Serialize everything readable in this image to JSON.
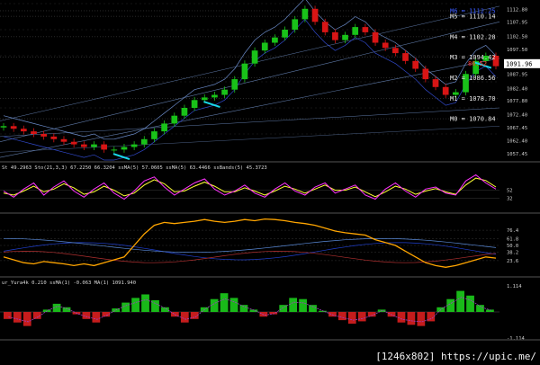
{
  "colors": {
    "background": "#000000",
    "bull": "#19c219",
    "bear": "#d81515",
    "grid": "#2a2a2a",
    "channel": "#5f7aa8",
    "level_text": "#e8e8e8",
    "level_text_blue": "#3a5bff",
    "price_label": "#ff3030",
    "arrow": "#19d8e8",
    "stoch_main": "#ff33ff",
    "stoch_sig": "#ffff33",
    "osc_orange": "#ffa500",
    "hist_pos": "#19b919",
    "hist_neg": "#c51c1c"
  },
  "chart_data": [
    {
      "type": "line",
      "name": "price",
      "x": [
        0,
        10,
        20,
        30,
        40,
        50,
        60,
        70,
        80,
        90,
        100,
        110,
        120,
        130,
        140,
        150,
        160,
        170,
        180,
        190,
        200,
        210,
        220,
        230,
        240,
        250,
        260,
        270,
        280,
        290,
        300,
        310,
        320,
        330,
        340,
        350,
        360,
        370,
        380,
        390,
        400,
        410,
        420,
        430,
        440,
        450,
        460,
        470,
        480,
        490
      ],
      "y": [
        1068,
        1067,
        1066,
        1065,
        1064,
        1063,
        1062,
        1061,
        1060,
        1061,
        1059,
        1059,
        1060,
        1061,
        1063,
        1066,
        1069,
        1072,
        1075,
        1078,
        1079,
        1080,
        1082,
        1086,
        1092,
        1097,
        1100,
        1102,
        1105,
        1109,
        1113,
        1108,
        1104,
        1101,
        1103,
        1106,
        1104,
        1100,
        1098,
        1096,
        1093,
        1090,
        1086,
        1083,
        1080,
        1081,
        1088,
        1093,
        1095,
        1091
      ],
      "ylim": [
        1055,
        1115
      ],
      "y_axis_ticks": [
        "1112.80",
        "1107.95",
        "1102.50",
        "1097.50",
        "1092.75",
        "1087.95",
        "1082.40",
        "1077.80",
        "1072.40",
        "1067.45",
        "1062.40",
        "1057.45"
      ],
      "current_price": "1091.96",
      "levels": [
        {
          "label": "M6 = 1112.25",
          "value": 1112.25,
          "style": "blue"
        },
        {
          "label": "M5 = 1110.14",
          "value": 1110.14,
          "style": "white"
        },
        {
          "label": "M4 = 1102.28",
          "value": 1102.28,
          "style": "white"
        },
        {
          "label": "M3 = 1094.42",
          "value": 1094.42,
          "style": "white"
        },
        {
          "label": "M2 = 1086.56",
          "value": 1086.56,
          "style": "white"
        },
        {
          "label": "M1 = 1078.70",
          "value": 1078.7,
          "style": "white"
        },
        {
          "label": "M0 = 1070.84",
          "value": 1070.84,
          "style": "white"
        }
      ],
      "price_labels": [
        {
          "label": "86.52",
          "value": 1092.0
        }
      ]
    },
    {
      "type": "line",
      "name": "stochastic",
      "header": "St 49.2963  Sto(21,3,3) 67.2250 66.3204  ssMA(5) 57.0605  ssMA(5) 63.4466  ssBands(5) 45.3723",
      "y_axis_ticks": [
        "52",
        "32"
      ],
      "ylim": [
        0,
        100
      ],
      "main": [
        50,
        35,
        55,
        70,
        40,
        60,
        75,
        50,
        35,
        55,
        70,
        45,
        30,
        50,
        75,
        85,
        60,
        40,
        55,
        70,
        80,
        55,
        40,
        50,
        65,
        45,
        35,
        55,
        70,
        50,
        40,
        60,
        70,
        45,
        55,
        65,
        40,
        30,
        55,
        70,
        50,
        35,
        55,
        60,
        45,
        40,
        75,
        90,
        70,
        55
      ],
      "signal": [
        45,
        40,
        50,
        62,
        48,
        55,
        68,
        58,
        42,
        48,
        62,
        52,
        38,
        45,
        65,
        78,
        68,
        48,
        50,
        62,
        72,
        62,
        48,
        48,
        58,
        50,
        40,
        50,
        62,
        55,
        45,
        55,
        65,
        52,
        52,
        60,
        48,
        36,
        48,
        62,
        55,
        42,
        50,
        56,
        48,
        42,
        65,
        82,
        76,
        60
      ]
    },
    {
      "type": "line",
      "name": "oscillator",
      "y_axis_ticks": [
        "76.4",
        "61.8",
        "50.0",
        "38.2",
        "23.6"
      ],
      "ylim": [
        0,
        100
      ],
      "orange": [
        30,
        25,
        20,
        18,
        22,
        20,
        18,
        15,
        18,
        15,
        20,
        25,
        30,
        50,
        70,
        85,
        90,
        88,
        90,
        92,
        95,
        92,
        90,
        92,
        95,
        93,
        96,
        95,
        93,
        90,
        88,
        85,
        80,
        75,
        72,
        70,
        68,
        60,
        55,
        50,
        40,
        30,
        20,
        15,
        12,
        15,
        20,
        25,
        30,
        28
      ]
    },
    {
      "type": "bar",
      "name": "histogram",
      "header": "ur_Yura4k 0.210   ssMA(1) -0.063  MA(1) 1091.940",
      "y_axis_ticks": [
        "1.114",
        "-1.114"
      ],
      "ylim": [
        -1.114,
        1.114
      ],
      "values": [
        -0.3,
        -0.45,
        -0.6,
        -0.3,
        0.1,
        0.35,
        0.2,
        -0.1,
        -0.3,
        -0.45,
        -0.2,
        0.15,
        0.4,
        0.6,
        0.75,
        0.5,
        0.2,
        -0.2,
        -0.45,
        -0.3,
        0.2,
        0.55,
        0.8,
        0.6,
        0.3,
        0.1,
        -0.2,
        -0.1,
        0.3,
        0.6,
        0.55,
        0.3,
        0.05,
        -0.2,
        -0.35,
        -0.5,
        -0.4,
        -0.2,
        0.1,
        -0.2,
        -0.45,
        -0.55,
        -0.6,
        -0.4,
        0.2,
        0.55,
        0.9,
        0.7,
        0.3,
        0.1
      ]
    }
  ],
  "watermark": "[1246x802] https://upic.me/"
}
